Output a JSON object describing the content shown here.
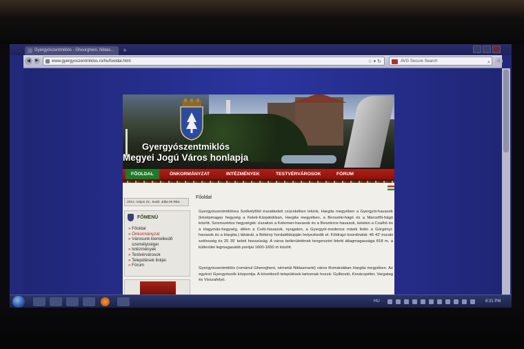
{
  "browser": {
    "tab_title": "Gyergyószentmiklós - Gheorgheni, Niklas...",
    "new_tab": "+",
    "url": "www.gyergyoszentmiklos.ro/hu/fooldal.html",
    "search_placeholder": "AVG Secure Search",
    "search_icon": "search-icon"
  },
  "site": {
    "title_line1": "Gyergyószentmiklós",
    "title_line2": "Megyei Jogú Város honlapja",
    "nav": [
      {
        "label": "FŐOLDAL",
        "active": true
      },
      {
        "label": "ÖNKORMÁNYZAT"
      },
      {
        "label": "INTÉZMÉNYEK"
      },
      {
        "label": "TESTVÉRVÁROSOK"
      },
      {
        "label": "FÓRUM"
      }
    ],
    "date": "2012. május 22., kedd.",
    "nameday_names": "Júlia és Rita.",
    "menu_title": "FŐMENÜ",
    "menu_items": [
      "Főoldal",
      "Önkormányzat",
      "Városunk kiemelkedő",
      "személyiségei",
      "Intézmények",
      "Testvérvárosok",
      "Települések linkjei",
      "Fórum"
    ],
    "page_heading": "Főoldal",
    "paragraph1": "Gyergyószentmiklósra Székelyföld északkeleti csücskében lelünk, Hargita megyében a Gyergyói-havasok (középmagas hegység a Keleti-Kárpátokban, Hargita megyében, a Borszéki-hágó és a Marosfői-hágó között. Szomszédos hegységek: északon a Kelemen-havasok és a Beszterce-havasok, keleten a Csalhó és a Hagymás-hegység, délen a Csíki-havasok, nyugaton, a Gyergyói-medence másik felén a Görgényi-havasok és a Hargita.) lábánál, a Békény hordalékkúpján helyezkedik el. Földrajzi koordinátái: 46 42' északi szélesség és 25 35' keleti hosszúság. A város belterületének tengerszint feletti átlagmagassága 818 m, a külterület legmagasabb pontjai 1600-1650 m között.",
    "paragraph2": "Gyergyószentmiklós (románul Gheorgheni, németül Niklasmarkt) város Romániában Hargita megyében. Az egykori Gyergyószék központja. A következő települések tartoznak hozzá: Gyilkostó, Kovácspéter, Vargatag és Visszafolyó."
  },
  "taskbar": {
    "language": "HU",
    "clock": "8:31 PM"
  }
}
